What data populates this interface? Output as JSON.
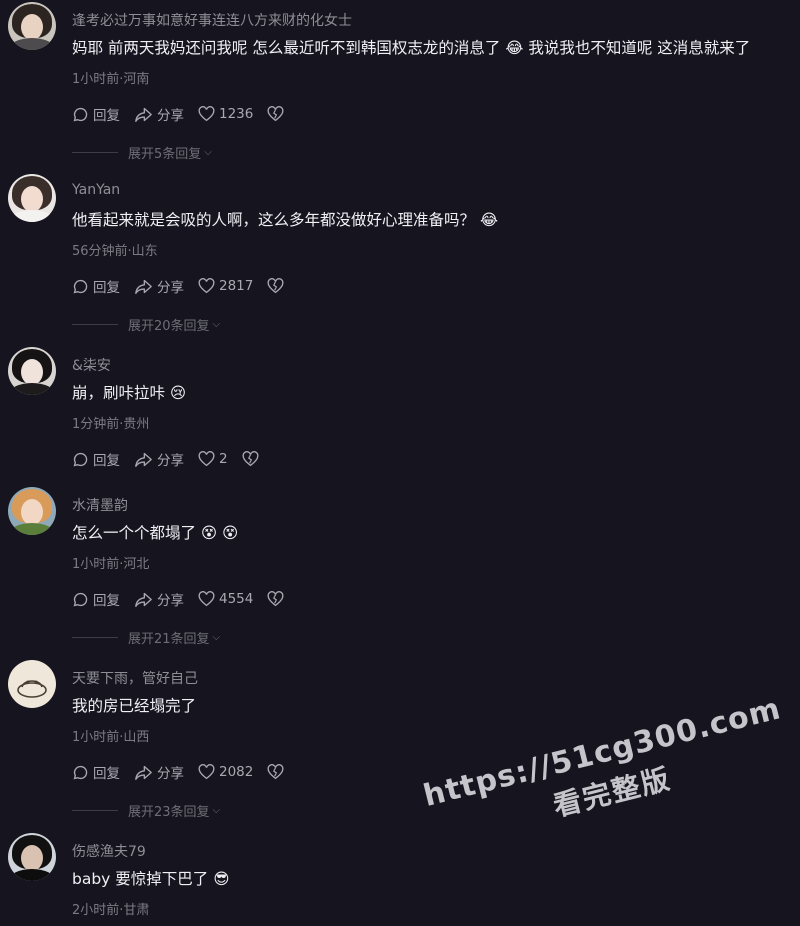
{
  "comments": [
    {
      "username": "逢考必过万事如意好事连连八方来财的化女士",
      "text": "妈耶 前两天我妈还问我呢 怎么最近听不到韩国权志龙的消息了 😂 我说我也不知道呢 这消息就来了",
      "meta": "1小时前·河南",
      "reply": "回复",
      "share": "分享",
      "likes": "1236",
      "expand": "展开5条回复"
    },
    {
      "username": "YanYan",
      "text": "他看起来就是会吸的人啊，这么多年都没做好心理准备吗？ 😂",
      "meta": "56分钟前·山东",
      "reply": "回复",
      "share": "分享",
      "likes": "2817",
      "expand": "展开20条回复"
    },
    {
      "username": "&柒安",
      "text": "崩，刷咔拉咔 😢",
      "meta": "1分钟前·贵州",
      "reply": "回复",
      "share": "分享",
      "likes": "2",
      "expand": ""
    },
    {
      "username": "水清墨韵",
      "text": "怎么一个个都塌了 😵 😵",
      "meta": "1小时前·河北",
      "reply": "回复",
      "share": "分享",
      "likes": "4554",
      "expand": "展开21条回复"
    },
    {
      "username": "天要下雨，管好自己",
      "text": "我的房已经塌完了",
      "meta": "1小时前·山西",
      "reply": "回复",
      "share": "分享",
      "likes": "2082",
      "expand": "展开23条回复"
    },
    {
      "username": "伤感渔夫79",
      "text": "baby 要惊掉下巴了 😎",
      "meta": "2小时前·甘肃",
      "reply": "",
      "share": "",
      "likes": "",
      "expand": ""
    }
  ],
  "watermark": {
    "line1": "https://51cg300.com",
    "line2": "看完整版"
  },
  "colors": {
    "background": "#16151f",
    "username": "#8f8e96",
    "text": "#f0eff4",
    "meta": "#7c7b84"
  }
}
